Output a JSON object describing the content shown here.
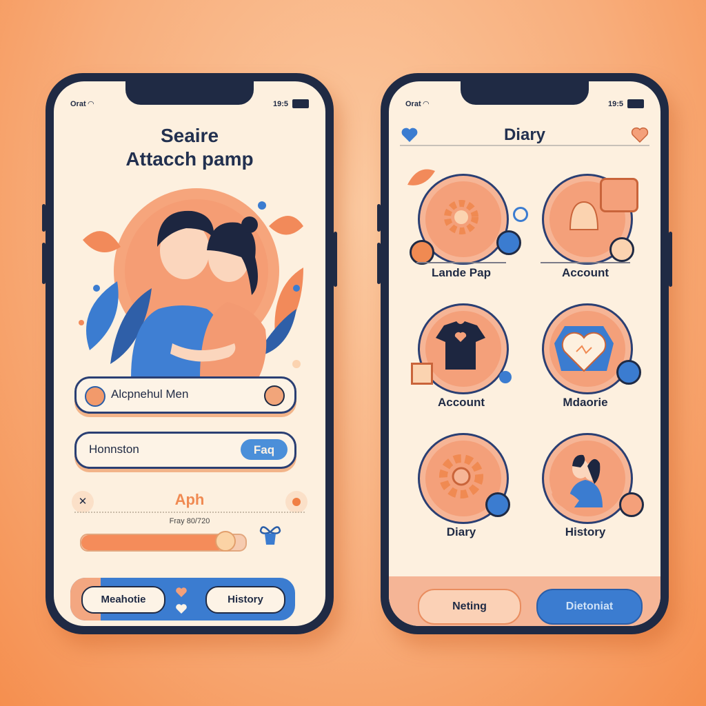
{
  "colors": {
    "background": "#f8ae7c",
    "phone_frame": "#1f2a44",
    "screen": "#fdf0df",
    "accent_orange": "#f58c5a",
    "accent_blue": "#3b7cd0"
  },
  "left_phone": {
    "status": {
      "carrier": "Orat",
      "time": "19:5"
    },
    "title_line1": "Seaire",
    "title_line2": "Attacch pamp",
    "search_pill": {
      "label": "Alcpnehul Men"
    },
    "faq_pill": {
      "label": "Honnston",
      "button": "Faq"
    },
    "aph_label": "Aph",
    "progress_label": "Fray 80/720",
    "progress_fraction": 0.88,
    "bottom": {
      "left_button": "Meahotie",
      "right_button": "History"
    }
  },
  "right_phone": {
    "status": {
      "carrier": "Orat",
      "time": "19:5"
    },
    "header_title": "Diary",
    "cards": [
      {
        "label": "Lande Pap",
        "icon": "gear-icon"
      },
      {
        "label": "Account",
        "icon": "bell-icon"
      },
      {
        "label": "Account",
        "icon": "tshirt-icon"
      },
      {
        "label": "Mdaorie",
        "icon": "heart-icon"
      },
      {
        "label": "Diary",
        "icon": "gear-icon"
      },
      {
        "label": "History",
        "icon": "couple-icon"
      }
    ],
    "bottom": {
      "left_button": "Neting",
      "right_button": "Dietoniat"
    }
  }
}
